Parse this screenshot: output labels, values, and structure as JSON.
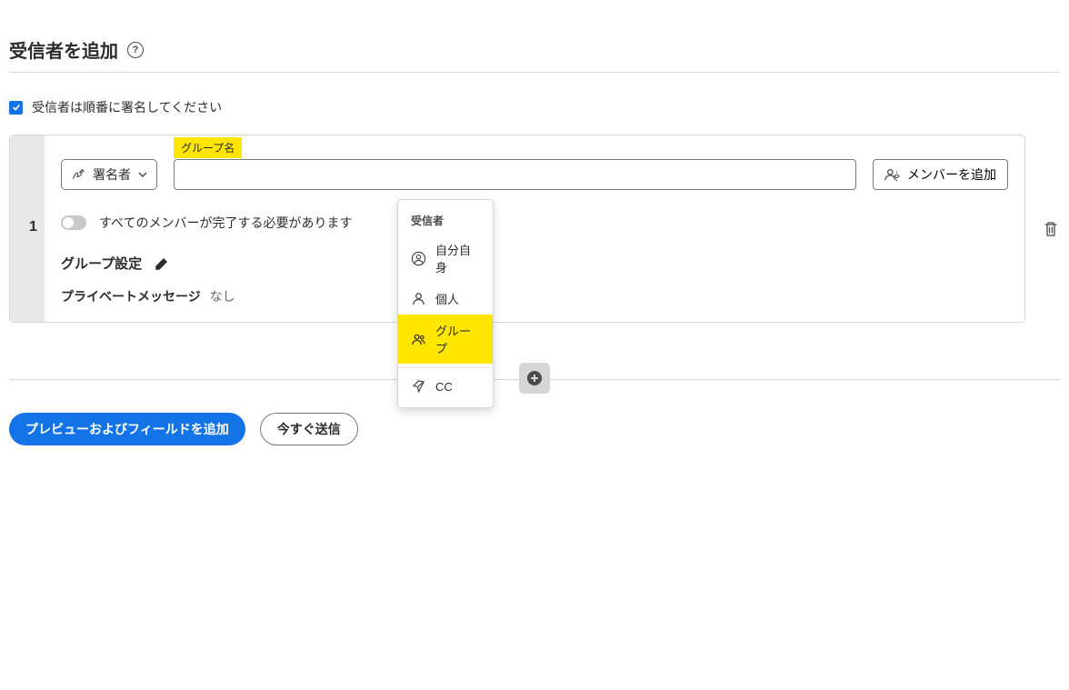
{
  "header": {
    "title": "受信者を追加"
  },
  "order_checkbox_label": "受信者は順番に署名してください",
  "recipient": {
    "order": "1",
    "role_label": "署名者",
    "group_name_label": "グループ名",
    "group_name_value": "",
    "add_member_label": "メンバーを追加",
    "all_complete_label": "すべてのメンバーが完了する必要があります",
    "group_settings_label": "グループ設定",
    "private_msg_label": "プライベートメッセージ",
    "private_msg_value": "なし"
  },
  "dropdown": {
    "header": "受信者",
    "items": [
      {
        "key": "myself",
        "label": "自分自身",
        "highlighted": false
      },
      {
        "key": "individual",
        "label": "個人",
        "highlighted": false
      },
      {
        "key": "group",
        "label": "グループ",
        "highlighted": true
      }
    ],
    "cc_label": "CC"
  },
  "footer": {
    "preview_btn": "プレビューおよびフィールドを追加",
    "send_btn": "今すぐ送信"
  }
}
